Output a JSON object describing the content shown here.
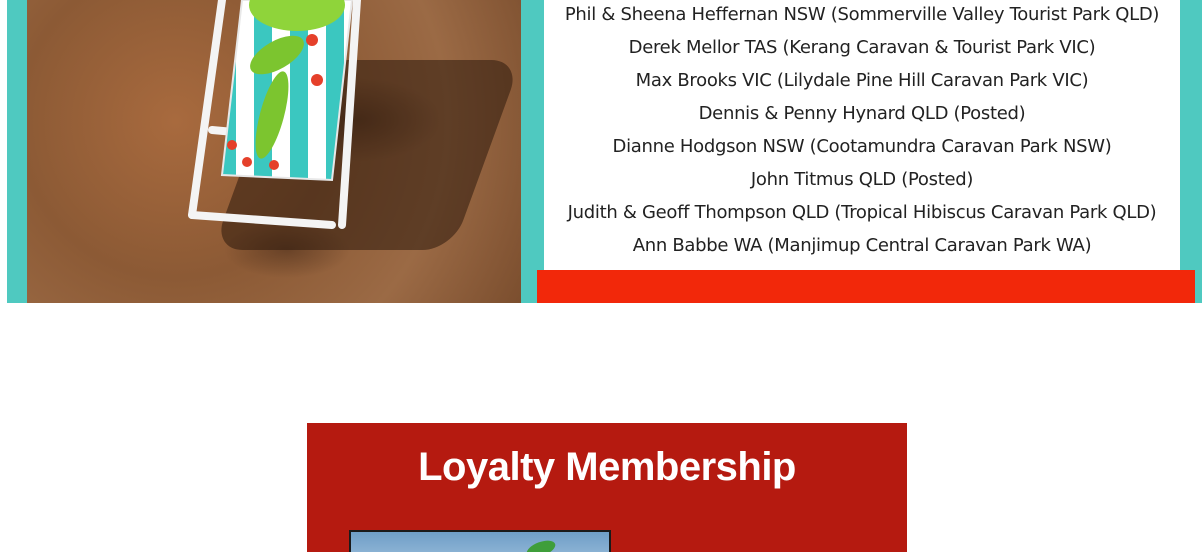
{
  "winners": {
    "lines": [
      "Phil & Sheena Heffernan NSW (Sommerville Valley Tourist Park QLD)",
      "Derek Mellor TAS (Kerang Caravan & Tourist Park VIC)",
      "Max Brooks VIC (Lilydale Pine Hill Caravan Park VIC)",
      "Dennis & Penny Hynard QLD (Posted)",
      "Dianne Hodgson NSW (Cootamundra Caravan Park NSW)",
      "John Titmus QLD (Posted)",
      "Judith & Geoff Thompson QLD (Tropical Hibiscus Caravan Park QLD)",
      "Ann Babbe WA (Manjimup Central Caravan Park WA)"
    ]
  },
  "loyalty": {
    "title": "Loyalty Membership"
  },
  "colors": {
    "teal": "#4fc9c0",
    "red_strip": "#f2280a",
    "loyalty_bg": "#b51a10"
  }
}
